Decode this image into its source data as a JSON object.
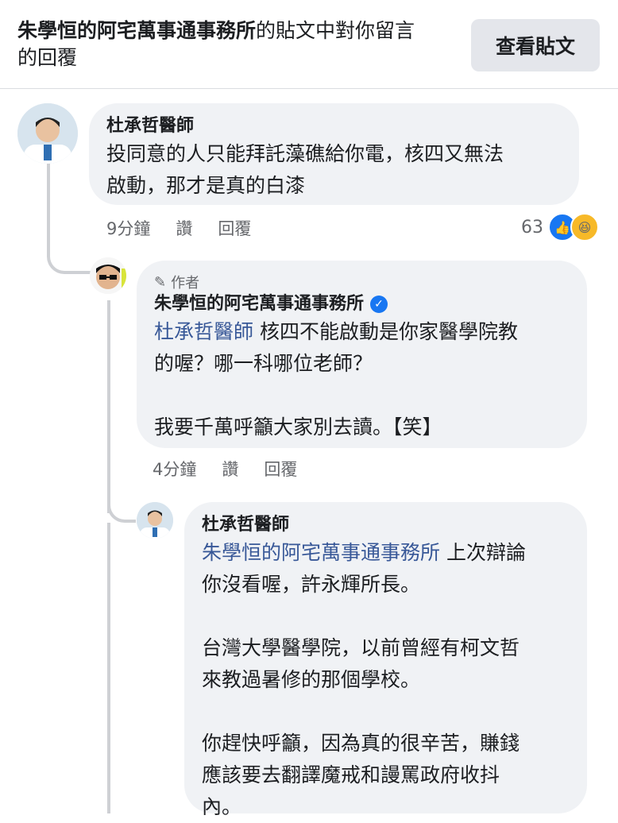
{
  "header": {
    "page_name": "朱學恒的阿宅萬事通事務所",
    "title_rest": "的貼文中對你留言",
    "title_line2": "的回覆",
    "view_post_label": "查看貼文"
  },
  "comments": [
    {
      "author": "杜承哲醫師",
      "text": "投同意的人只能拜託藻礁給你電，核四又無法\n啟動，那才是真的白漆",
      "time": "9分鐘",
      "like_label": "讚",
      "reply_label": "回覆",
      "reaction_count": "63",
      "reactions": [
        "like-icon",
        "haha-icon"
      ]
    },
    {
      "author_tag": "作者",
      "author": "朱學恒的阿宅萬事通事務所",
      "verified": true,
      "mention": "杜承哲醫師",
      "text_line1_rest": " 核四不能啟動是你家醫學院教",
      "text_rest": "的喔？哪一科哪位老師？\n\n我要千萬呼籲大家別去讀。【笑】",
      "time": "4分鐘",
      "like_label": "讚",
      "reply_label": "回覆"
    },
    {
      "author": "杜承哲醫師",
      "mention": "朱學恒的阿宅萬事通事務所",
      "text_line1_rest": " 上次辯論",
      "text_rest": "你沒看喔，許永輝所長。\n\n台灣大學醫學院，以前曾經有柯文哲\n來教過暑修的那個學校。\n\n你趕快呼籲，因為真的很辛苦，賺錢\n應該要去翻譯魔戒和謾罵政府收抖\n內。"
    }
  ],
  "colors": {
    "mention": "#385898",
    "bubble": "#f0f2f5",
    "meta": "#65676b",
    "verified": "#1877f2"
  }
}
